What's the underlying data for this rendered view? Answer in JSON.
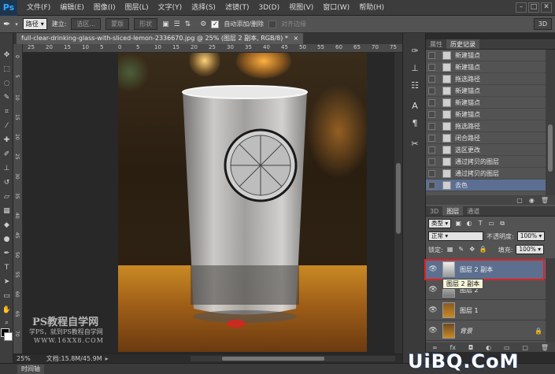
{
  "app": {
    "logo": "Ps",
    "menus": [
      "文件(F)",
      "编辑(E)",
      "图像(I)",
      "图层(L)",
      "文字(Y)",
      "选择(S)",
      "滤镜(T)",
      "3D(D)",
      "视图(V)",
      "窗口(W)",
      "帮助(H)"
    ]
  },
  "options": {
    "tool_mode": "路径",
    "build_label": "建立:",
    "selection_btn": "选区...",
    "mask_btn": "蒙版",
    "shape_btn": "形状",
    "auto_add_delete": "自动添加/删除",
    "align_edges": "对齐边缘",
    "view_3d": "3D"
  },
  "document": {
    "tab_title": "full-clear-drinking-glass-with-sliced-lemon-2336670.jpg @ 25% (图层 2 副本, RGB/8) *",
    "ruler_h": [
      "25",
      "20",
      "15",
      "10",
      "5",
      "0",
      "5",
      "10",
      "15",
      "20",
      "25",
      "30",
      "35",
      "40",
      "45",
      "50",
      "55",
      "60",
      "65",
      "70",
      "75"
    ],
    "ruler_v": [
      "0",
      "5",
      "10",
      "15",
      "20",
      "25",
      "30",
      "35",
      "40",
      "45",
      "50",
      "55",
      "60",
      "65",
      "70"
    ],
    "watermark_title": "PS教程自学网",
    "watermark_sub": "学PS，就到PS教程自学网",
    "watermark_url": "WWW.16XX8.COM"
  },
  "status": {
    "zoom": "25%",
    "doc_size": "文档:15.8M/45.9M",
    "timeline_tab": "时间轴"
  },
  "history": {
    "tab_properties": "属性",
    "tab_history": "历史记录",
    "items": [
      "新建锚点",
      "新建锚点",
      "拖选路径",
      "新建锚点",
      "新建锚点",
      "新建锚点",
      "拖选路径",
      "闭合路径",
      "选区更改",
      "通过拷贝的图层",
      "通过拷贝的图层",
      "去色"
    ],
    "selected_index": 11
  },
  "layers": {
    "tab_3d": "3D",
    "tab_layers": "图层",
    "tab_channels": "通道",
    "kind_filter": "类型",
    "blend_mode": "正常",
    "opacity_label": "不透明度:",
    "opacity_value": "100%",
    "lock_label": "锁定:",
    "fill_label": "填充:",
    "fill_value": "100%",
    "items": [
      "图层 2 副本",
      "图层 2",
      "图层 1",
      "背景"
    ],
    "selected_index": 0,
    "tooltip": "图层 2 副本"
  },
  "site_watermark": "UiBQ.CoM"
}
